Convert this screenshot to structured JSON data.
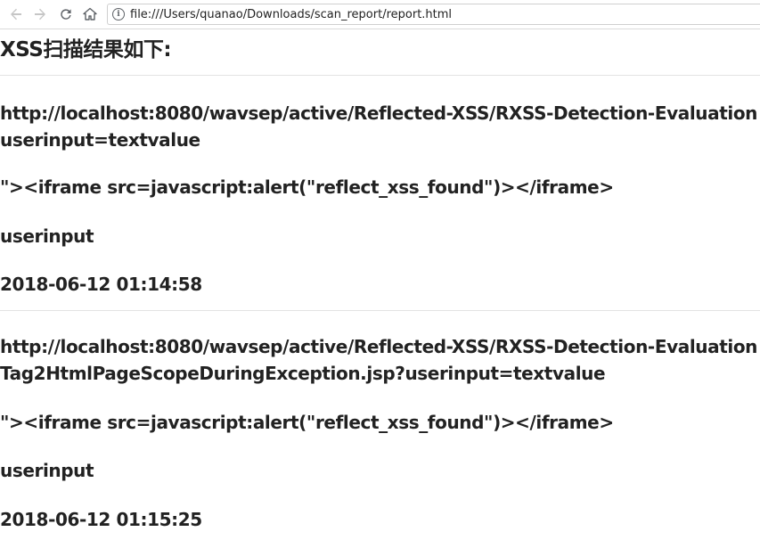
{
  "browser": {
    "address_bar": {
      "url": "file:///Users/quanao/Downloads/scan_report/report.html"
    }
  },
  "page": {
    "title": "XSS扫描结果如下:",
    "results": [
      {
        "url_line1": "http://localhost:8080/wavsep/active/Reflected-XSS/RXSS-Detection-Evaluation",
        "url_line2": "userinput=textvalue",
        "payload": "\"><iframe src=javascript:alert(\"reflect_xss_found\")></iframe>",
        "param": "userinput",
        "timestamp": "2018-06-12 01:14:58"
      },
      {
        "url_line1": "http://localhost:8080/wavsep/active/Reflected-XSS/RXSS-Detection-Evaluation",
        "url_line2": "Tag2HtmlPageScopeDuringException.jsp?userinput=textvalue",
        "payload": "\"><iframe src=javascript:alert(\"reflect_xss_found\")></iframe>",
        "param": "userinput",
        "timestamp": "2018-06-12 01:15:25"
      }
    ]
  }
}
